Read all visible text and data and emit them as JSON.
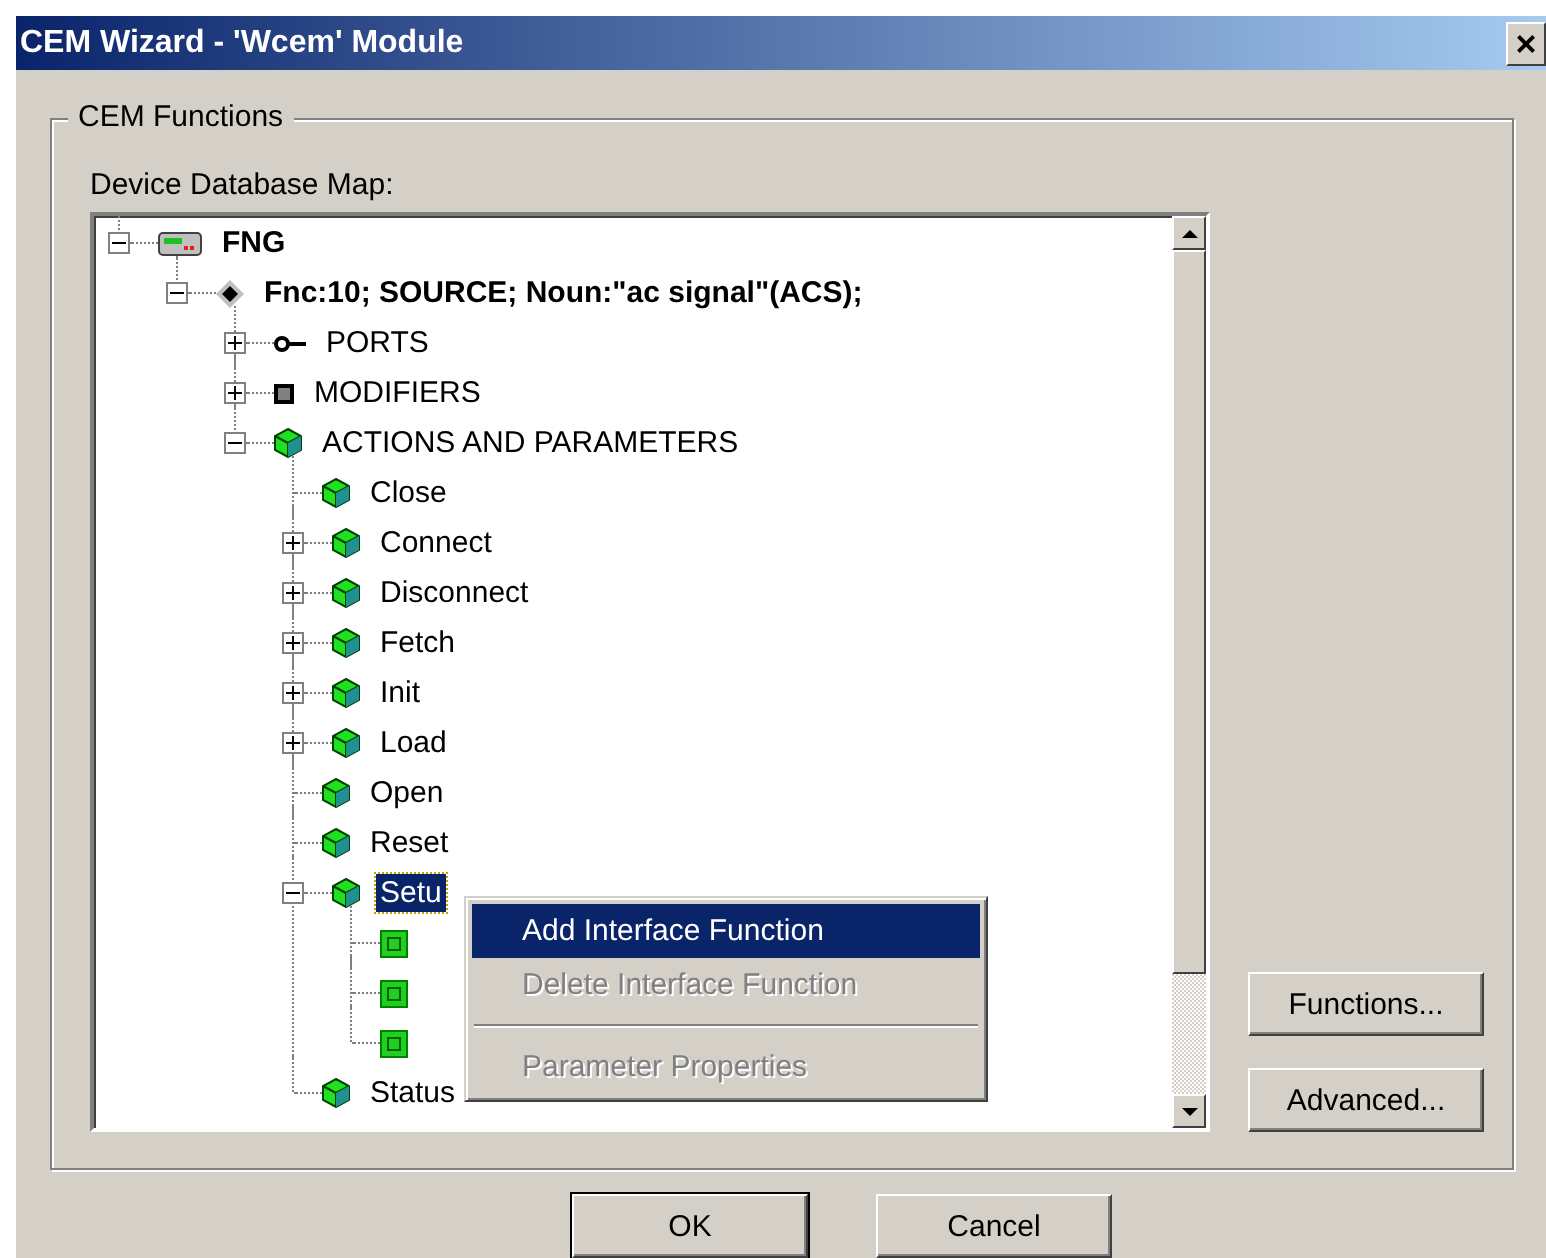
{
  "window": {
    "title": "CEM Wizard - 'Wcem' Module",
    "close": "×"
  },
  "group": {
    "title": "CEM Functions",
    "label": "Device Database Map:"
  },
  "tree": [
    {
      "kind": "device",
      "label": "FNG",
      "expanded": true,
      "selected": false,
      "children": [
        {
          "kind": "function",
          "label": "Fnc:10; SOURCE; Noun:\"ac signal\"(ACS);",
          "expanded": true,
          "selected": false,
          "children": [
            {
              "kind": "port",
              "label": "PORTS",
              "expanded": false,
              "selected": false
            },
            {
              "kind": "modifier",
              "label": "MODIFIERS",
              "expanded": false,
              "selected": false
            },
            {
              "kind": "action",
              "label": "ACTIONS AND PARAMETERS",
              "expanded": true,
              "selected": false,
              "children": [
                {
                  "kind": "action",
                  "label": "Close",
                  "selected": false
                },
                {
                  "kind": "action",
                  "label": "Connect",
                  "expanded": false,
                  "selected": false
                },
                {
                  "kind": "action",
                  "label": "Disconnect",
                  "expanded": false,
                  "selected": false
                },
                {
                  "kind": "action",
                  "label": "Fetch",
                  "expanded": false,
                  "selected": false
                },
                {
                  "kind": "action",
                  "label": "Init",
                  "expanded": false,
                  "selected": false
                },
                {
                  "kind": "action",
                  "label": "Load",
                  "expanded": false,
                  "selected": false
                },
                {
                  "kind": "action",
                  "label": "Open",
                  "selected": false
                },
                {
                  "kind": "action",
                  "label": "Reset",
                  "selected": false
                },
                {
                  "kind": "action",
                  "label": "Setu",
                  "expanded": true,
                  "selected": true,
                  "children": [
                    {
                      "kind": "param"
                    },
                    {
                      "kind": "param"
                    },
                    {
                      "kind": "param"
                    }
                  ]
                },
                {
                  "kind": "action",
                  "label": "Status",
                  "selected": false
                }
              ]
            }
          ]
        }
      ]
    }
  ],
  "side_buttons": [
    "Functions...",
    "Advanced..."
  ],
  "context_menu": [
    {
      "kind": "item",
      "label": "Add Interface Function",
      "disabled": false,
      "selected": true
    },
    {
      "kind": "item",
      "label": "Delete Interface Function",
      "disabled": true,
      "selected": false
    },
    {
      "kind": "separator"
    },
    {
      "kind": "item",
      "label": "Parameter Properties",
      "disabled": true,
      "selected": false
    }
  ],
  "buttons": [
    {
      "label": "OK",
      "default": true
    },
    {
      "label": "Cancel",
      "default": false
    }
  ]
}
